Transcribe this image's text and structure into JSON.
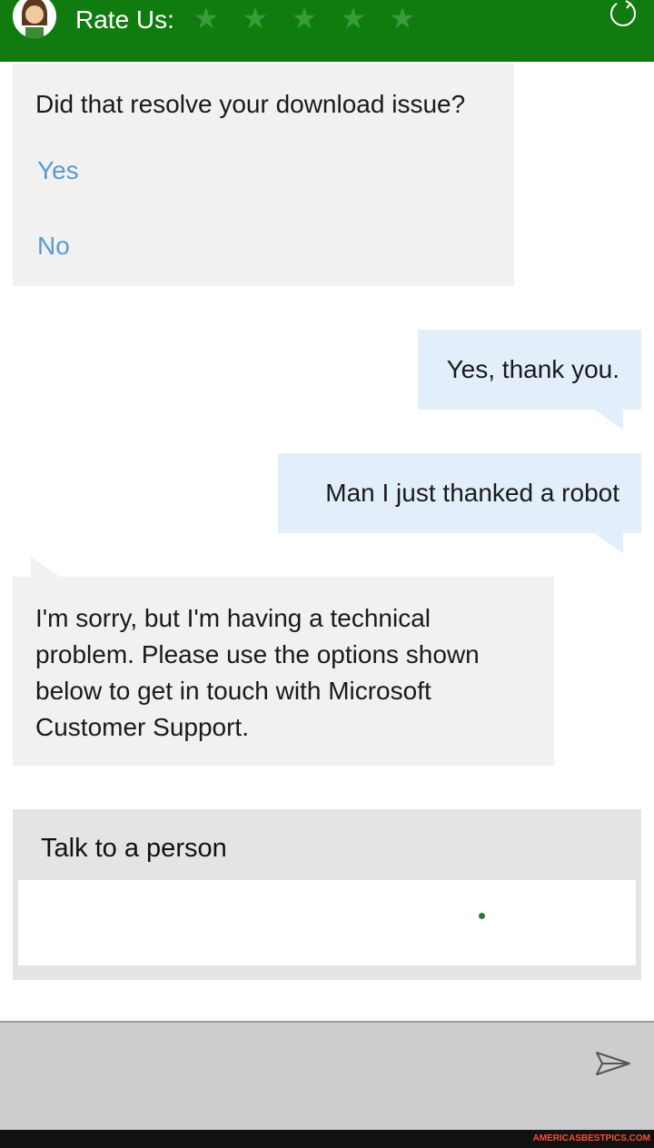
{
  "header": {
    "rate_label": "Rate Us:",
    "stars": [
      "★",
      "★",
      "★",
      "★",
      "★"
    ],
    "rating_selected": 0,
    "avatar_icon": "agent-avatar-icon",
    "refresh_icon": "refresh-icon"
  },
  "messages": [
    {
      "from": "bot",
      "text": "Did that resolve your download issue?",
      "options": [
        "Yes",
        "No"
      ]
    },
    {
      "from": "user",
      "text": "Yes, thank you."
    },
    {
      "from": "user",
      "text": "Man I just thanked a robot"
    },
    {
      "from": "bot",
      "text": "I'm sorry, but I'm having a technical problem. Please use the options shown below to get in touch with Microsoft Customer Support."
    }
  ],
  "contact_card": {
    "title": "Talk to a person",
    "loading_icon": "loading-dot-icon"
  },
  "input_bar": {
    "send_icon": "send-icon"
  },
  "footer": {
    "watermark": "AMERICASBESTPICS.COM"
  },
  "colors": {
    "brand_green": "#107c10",
    "bot_bubble": "#f1f1f1",
    "user_bubble": "#e2eefa",
    "link_blue": "#5b9bd0"
  }
}
